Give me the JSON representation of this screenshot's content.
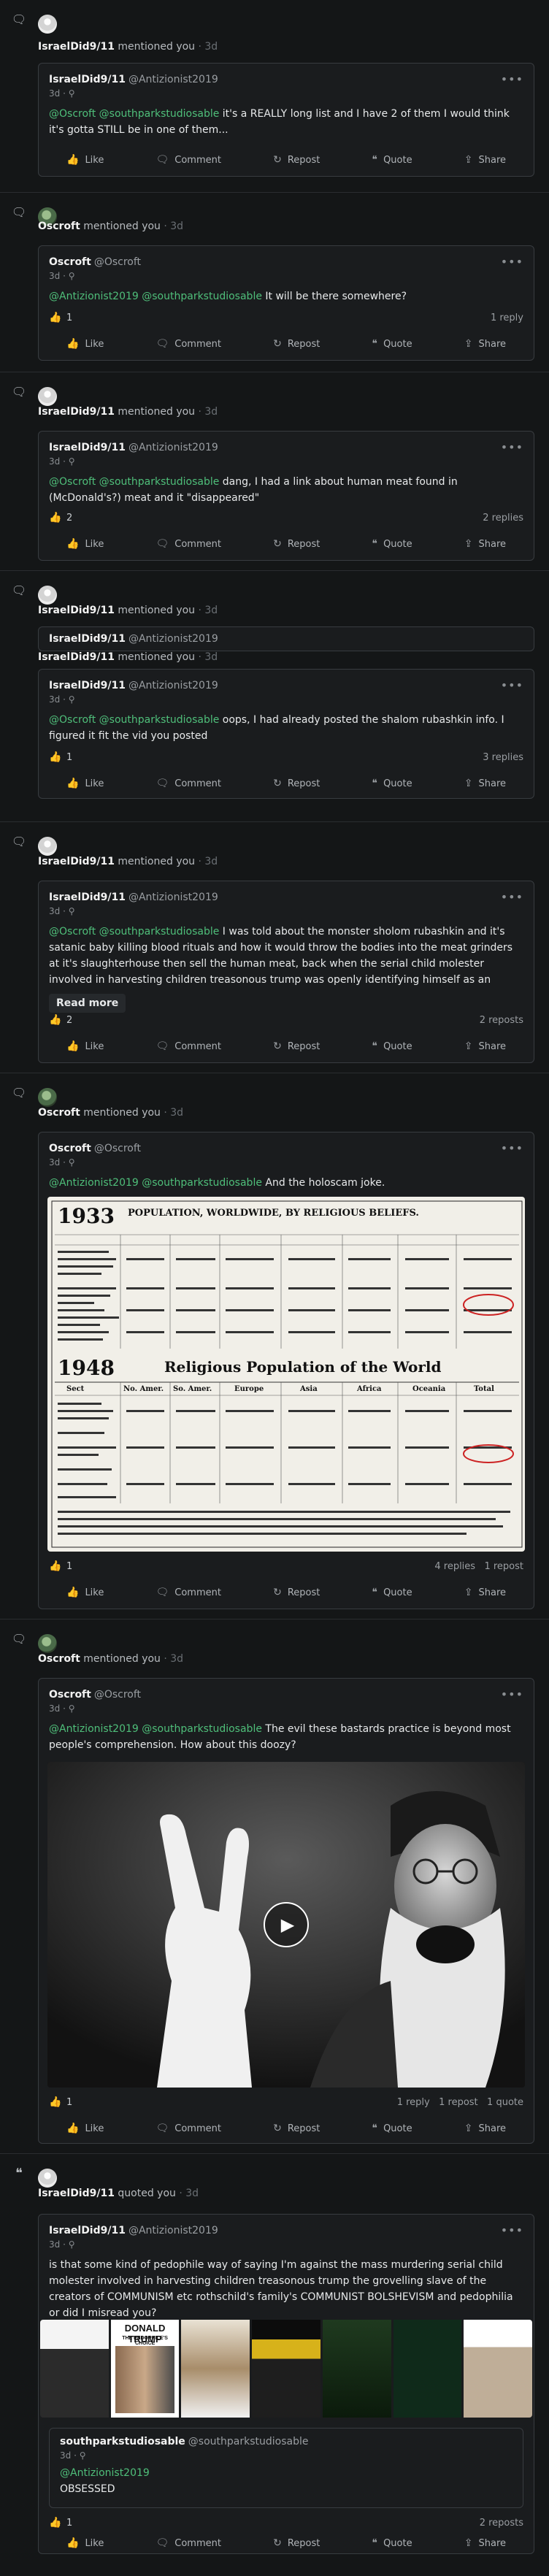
{
  "labels": {
    "like": "Like",
    "comment": "Comment",
    "repost": "Repost",
    "quote": "Quote",
    "share": "Share",
    "read_more": "Read more",
    "dots": "•••"
  },
  "notifications": [
    {
      "user": "IsraelDid9/11",
      "action": "mentioned you",
      "time": "· 3d",
      "post": {
        "name": "IsraelDid9/11",
        "handle": "@Antizionist2019",
        "meta": "3d · ⚲",
        "mentions": "@Oscroft @southparkstudiosable",
        "text": " it's a REALLY long list and I have 2 of them I would think it's gotta STILL be in one of them..."
      }
    },
    {
      "user": "Oscroft",
      "action": "mentioned you",
      "time": "· 3d",
      "post": {
        "name": "Oscroft",
        "handle": "@Oscroft",
        "meta": "3d · ⚲",
        "mentions": "@Antizionist2019 @southparkstudiosable",
        "text": " It will be there somewhere?",
        "likes": "1",
        "stats": "1 reply"
      }
    },
    {
      "user": "IsraelDid9/11",
      "action": "mentioned you",
      "time": "· 3d",
      "post": {
        "name": "IsraelDid9/11",
        "handle": "@Antizionist2019",
        "meta": "3d · ⚲",
        "mentions": "@Oscroft @southparkstudiosable",
        "text": " dang, I had a link about human meat found in (McDonald's?) meat and it \"disappeared\"",
        "likes": "2",
        "stats": "2 replies"
      }
    },
    {
      "user": "IsraelDid9/11",
      "action": "mentioned you",
      "time": "· 3d",
      "parent": {
        "name": "IsraelDid9/11",
        "handle": "@Antizionist2019"
      },
      "sub": {
        "user": "IsraelDid9/11",
        "action": "mentioned you",
        "time": "· 3d"
      },
      "post": {
        "name": "IsraelDid9/11",
        "handle": "@Antizionist2019",
        "meta": "3d · ⚲",
        "mentions": "@Oscroft @southparkstudiosable",
        "text": " oops, I had already posted the shalom rubashkin info. I figured it fit the vid you posted",
        "likes": "1",
        "stats": "3 replies"
      }
    },
    {
      "user": "IsraelDid9/11",
      "action": "mentioned you",
      "time": "· 3d",
      "post": {
        "name": "IsraelDid9/11",
        "handle": "@Antizionist2019",
        "meta": "3d · ⚲",
        "mentions": "@Oscroft @southparkstudiosable",
        "text": " I was told about the monster sholom rubashkin and it's satanic baby killing blood rituals and how it would throw the bodies into the meat grinders at it's slaughterhouse then sell the human meat, back when the serial child molester involved in harvesting children treasonous trump was openly identifying himself as an incestuous child",
        "likes": "2",
        "stats": "2 reposts"
      }
    },
    {
      "user": "Oscroft",
      "action": "mentioned you",
      "time": "· 3d",
      "post": {
        "name": "Oscroft",
        "handle": "@Oscroft",
        "meta": "3d · ⚲",
        "mentions": "@Antizionist2019 @southparkstudiosable",
        "text": " And the holoscam joke.",
        "likes": "1",
        "stats": "4 replies   1 repost"
      },
      "image": {
        "h1": "1933",
        "title1": "POPULATION, WORLDWIDE, BY RELIGIOUS BELIEFS.",
        "h2": "1948",
        "title2": "Religious Population of the World",
        "columns": [
          "Sect",
          "No. Amer.",
          "So. Amer.",
          "Europe",
          "Asia",
          "Africa",
          "Oceania",
          "Total"
        ]
      }
    },
    {
      "user": "Oscroft",
      "action": "mentioned you",
      "time": "· 3d",
      "post": {
        "name": "Oscroft",
        "handle": "@Oscroft",
        "meta": "3d · ⚲",
        "mentions": "@Antizionist2019 @southparkstudiosable",
        "text": " The evil these bastards practice is beyond most people's comprehension. How about this doozy?",
        "likes": "1",
        "stats": "1 reply   1 repost   1 quote"
      }
    },
    {
      "user": "IsraelDid9/11",
      "action": "quoted you",
      "time": "· 3d",
      "post": {
        "name": "IsraelDid9/11",
        "handle": "@Antizionist2019",
        "meta": "3d · ⚲",
        "text": "is that some kind of pedophile way of saying I'm against the mass murdering serial child molester involved in harvesting children treasonous trump the grovelling slave of the creators of COMMUNISM etc rothschild's family's COMMUNIST BOLSHEVISM and pedophilia or did I misread you?",
        "likes": "1",
        "stats": "2 reposts"
      },
      "collage": {
        "t2": "DONALD TRUMP",
        "t2b": "THE PEDOPHILE'S CHOICE"
      },
      "quoted": {
        "name": "southparkstudiosable",
        "handle": "@southparkstudiosable",
        "meta": "3d · ⚲",
        "mentions": "@Antizionist2019",
        "text": "OBSESSED"
      }
    }
  ]
}
